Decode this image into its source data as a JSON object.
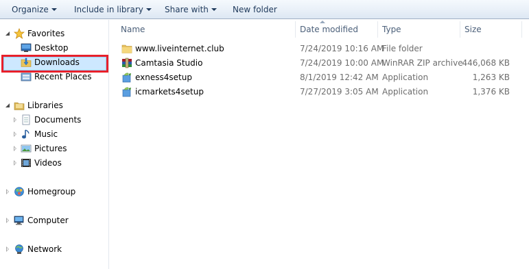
{
  "toolbar": {
    "organize": "Organize",
    "include_in_library": "Include in library",
    "share_with": "Share with",
    "new_folder": "New folder"
  },
  "nav": {
    "favorites": "Favorites",
    "desktop": "Desktop",
    "downloads": "Downloads",
    "recent_places": "Recent Places",
    "libraries": "Libraries",
    "documents": "Documents",
    "music": "Music",
    "pictures": "Pictures",
    "videos": "Videos",
    "homegroup": "Homegroup",
    "computer": "Computer",
    "network": "Network"
  },
  "columns": {
    "name": "Name",
    "date_modified": "Date modified",
    "type": "Type",
    "size": "Size"
  },
  "files": [
    {
      "name": "www.liveinternet.club",
      "date": "7/24/2019 10:16 AM",
      "type": "File folder",
      "size": "",
      "icon": "folder-icon"
    },
    {
      "name": "Camtasia Studio",
      "date": "7/24/2019 10:00 AM",
      "type": "WinRAR ZIP archive",
      "size": "446,068 KB",
      "icon": "winrar-archive-icon"
    },
    {
      "name": "exness4setup",
      "date": "8/1/2019 12:42 AM",
      "type": "Application",
      "size": "1,263 KB",
      "icon": "installer-icon"
    },
    {
      "name": "icmarkets4setup",
      "date": "7/27/2019 3:05 AM",
      "type": "Application",
      "size": "1,376 KB",
      "icon": "installer-icon"
    }
  ],
  "colors": {
    "selection_fill": "#cde8ff",
    "selection_border": "#99d1ff",
    "highlight_box": "#e8202a",
    "toolbar_text": "#1e395b"
  }
}
